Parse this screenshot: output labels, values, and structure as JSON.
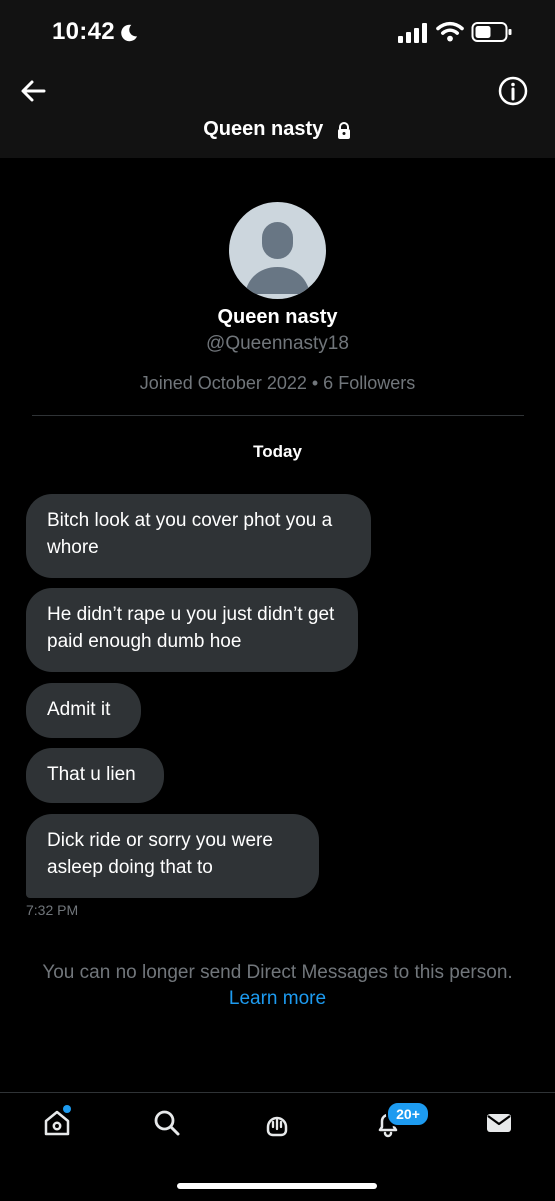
{
  "status_bar": {
    "time": "10:42",
    "icons": [
      "moon-icon",
      "signal-icon",
      "wifi-icon",
      "battery-icon"
    ]
  },
  "header": {
    "title": "Queen nasty",
    "icons": [
      "back-arrow-icon",
      "info-icon",
      "lock-icon"
    ]
  },
  "profile": {
    "name": "Queen nasty",
    "handle": "@Queennasty18",
    "meta": "Joined October 2022 • 6 Followers"
  },
  "conversation": {
    "date_label": "Today",
    "messages": [
      {
        "text": "Bitch look at you cover phot you a whore"
      },
      {
        "text": "He didn’t rape u you just didn’t get paid enough dumb hoe"
      },
      {
        "text": "Admit it"
      },
      {
        "text": "That u lien"
      },
      {
        "text": "Dick ride or sorry you were asleep doing that to"
      }
    ],
    "timestamp": "7:32 PM",
    "notice": "You can no longer send Direct Messages to this person.",
    "learn_more": "Learn more"
  },
  "bottom_nav": {
    "items": [
      "home-icon",
      "search-icon",
      "spaces-icon",
      "notifications-icon",
      "messages-icon"
    ],
    "notification_badge": "20+",
    "colors": {
      "accent": "#1d9bf0",
      "bubble": "#2f3336",
      "secondary_text": "#71767b"
    }
  }
}
